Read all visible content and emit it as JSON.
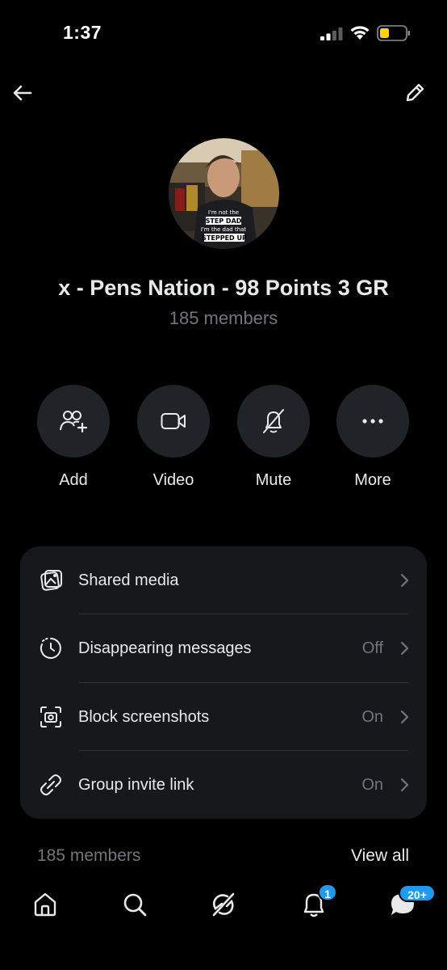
{
  "status_bar": {
    "time": "1:37"
  },
  "header": {
    "back_icon": "arrow-left-icon",
    "edit_icon": "pencil-icon"
  },
  "group": {
    "name": "x - Pens Nation - 98 Points 3 GR",
    "member_count": "185 members",
    "avatar_shirt_text": "I'm not the STEP DAD I'm the dad that STEPPED UP"
  },
  "actions": [
    {
      "label": "Add",
      "icon": "add-people-icon"
    },
    {
      "label": "Video",
      "icon": "video-camera-icon"
    },
    {
      "label": "Mute",
      "icon": "bell-off-icon"
    },
    {
      "label": "More",
      "icon": "ellipsis-icon"
    }
  ],
  "settings": [
    {
      "label": "Shared media",
      "value": "",
      "icon": "media-gallery-icon"
    },
    {
      "label": "Disappearing messages",
      "value": "Off",
      "icon": "timer-icon"
    },
    {
      "label": "Block screenshots",
      "value": "On",
      "icon": "screenshot-camera-icon"
    },
    {
      "label": "Group invite link",
      "value": "On",
      "icon": "link-icon"
    }
  ],
  "members_section": {
    "count_label": "185 members",
    "view_all_label": "View all"
  },
  "tabbar": {
    "items": [
      {
        "name": "home",
        "icon": "home-icon"
      },
      {
        "name": "explore",
        "icon": "search-icon"
      },
      {
        "name": "grok",
        "icon": "grok-icon"
      },
      {
        "name": "notifications",
        "icon": "bell-icon",
        "badge": "1"
      },
      {
        "name": "messages",
        "icon": "messages-icon",
        "badge": "20+"
      }
    ]
  },
  "colors": {
    "background": "#000000",
    "card": "#16181c",
    "action_circle": "#202327",
    "muted_text": "#71767b",
    "badge": "#1d9bf0",
    "battery": "#ffd400"
  }
}
